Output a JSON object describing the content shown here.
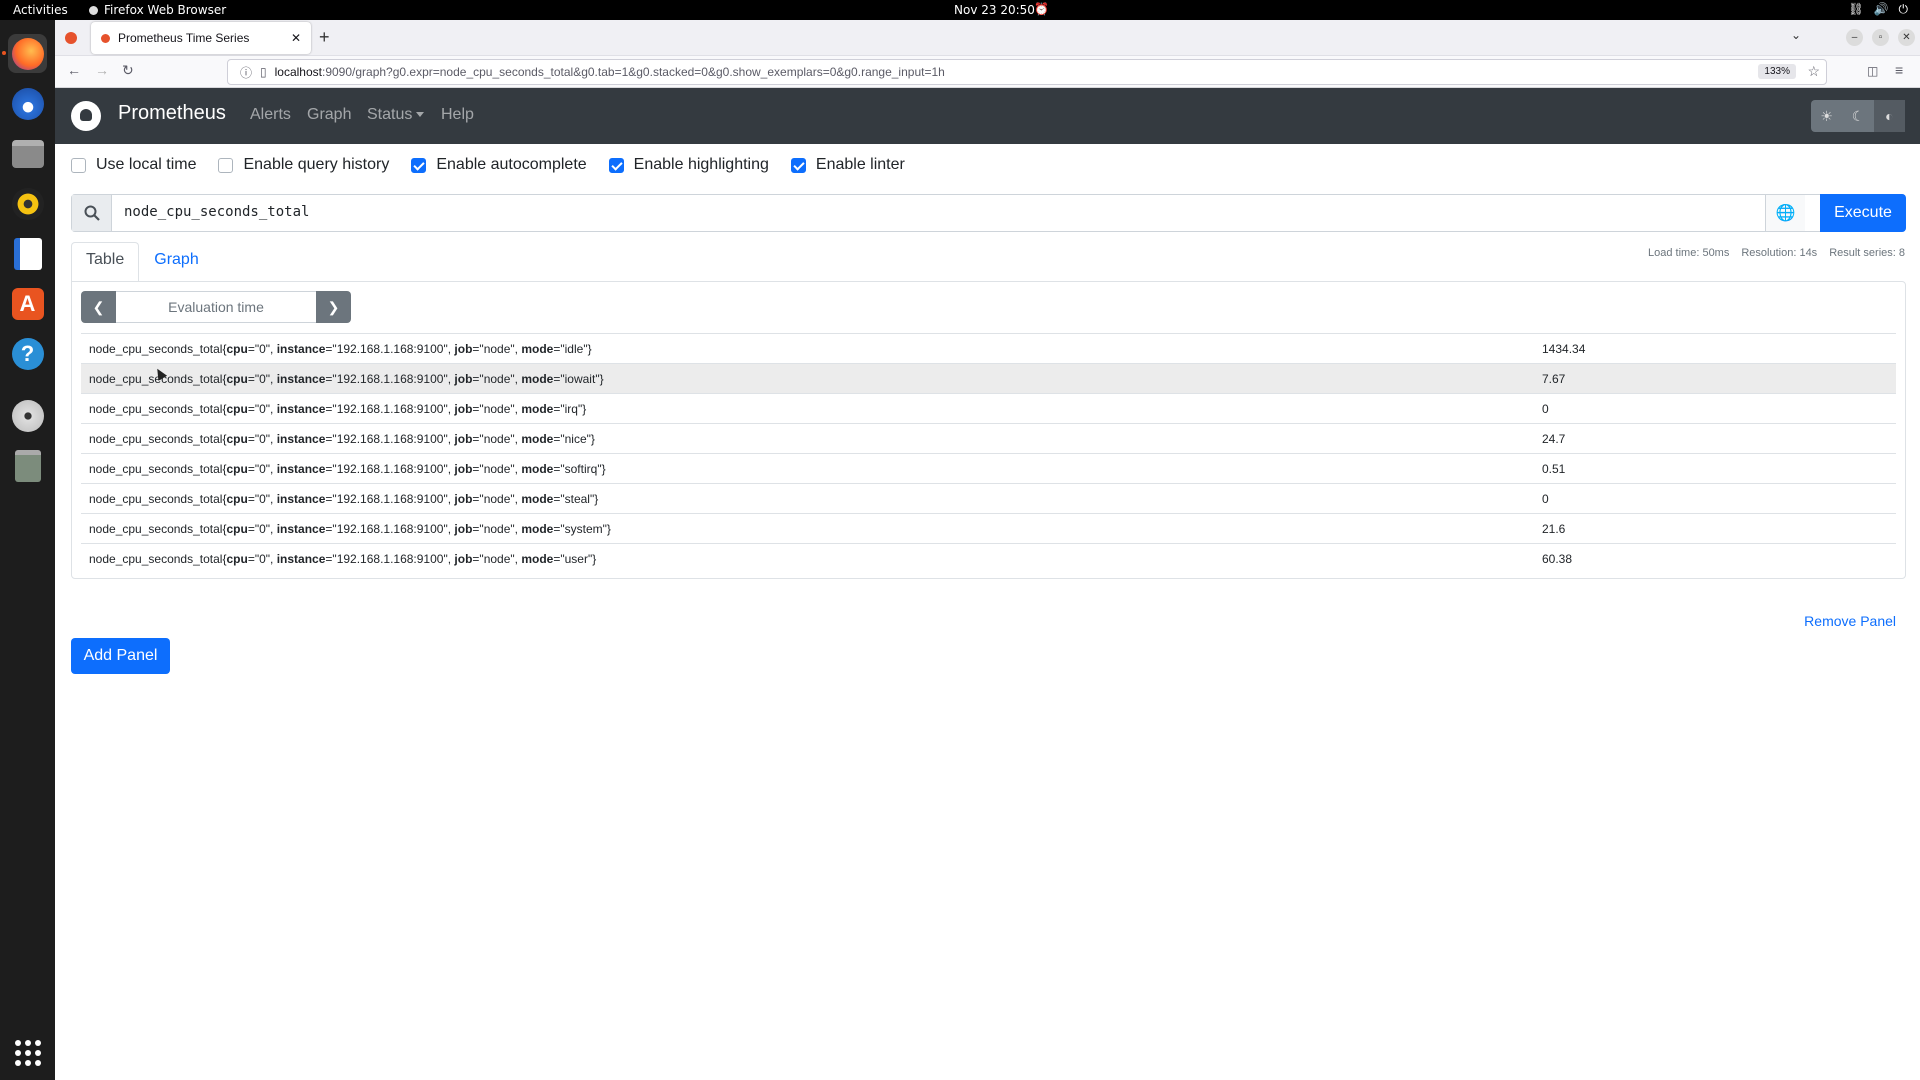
{
  "system": {
    "activities": "Activities",
    "app_name": "Firefox Web Browser",
    "clock": "Nov 23  20:50"
  },
  "browser": {
    "tab_title": "Prometheus Time Series",
    "url_host": "localhost",
    "url_path": ":9090/graph?g0.expr=node_cpu_seconds_total&g0.tab=1&g0.stacked=0&g0.show_exemplars=0&g0.range_input=1h",
    "zoom": "133%"
  },
  "prom": {
    "brand": "Prometheus",
    "nav": [
      "Alerts",
      "Graph",
      "Status",
      "Help"
    ]
  },
  "options": [
    {
      "label": "Use local time",
      "checked": false
    },
    {
      "label": "Enable query history",
      "checked": false
    },
    {
      "label": "Enable autocomplete",
      "checked": true
    },
    {
      "label": "Enable highlighting",
      "checked": true
    },
    {
      "label": "Enable linter",
      "checked": true
    }
  ],
  "query": {
    "expression": "node_cpu_seconds_total",
    "execute_label": "Execute"
  },
  "tabs": {
    "table": "Table",
    "graph": "Graph"
  },
  "stats": {
    "load_time": "Load time: 50ms",
    "resolution": "Resolution: 14s",
    "result_series": "Result series: 8"
  },
  "eval_time_placeholder": "Evaluation time",
  "results": [
    {
      "name": "node_cpu_seconds_total",
      "cpu": "0",
      "instance": "192.168.1.168:9100",
      "job": "node",
      "mode": "idle",
      "value": "1434.34"
    },
    {
      "name": "node_cpu_seconds_total",
      "cpu": "0",
      "instance": "192.168.1.168:9100",
      "job": "node",
      "mode": "iowait",
      "value": "7.67"
    },
    {
      "name": "node_cpu_seconds_total",
      "cpu": "0",
      "instance": "192.168.1.168:9100",
      "job": "node",
      "mode": "irq",
      "value": "0"
    },
    {
      "name": "node_cpu_seconds_total",
      "cpu": "0",
      "instance": "192.168.1.168:9100",
      "job": "node",
      "mode": "nice",
      "value": "24.7"
    },
    {
      "name": "node_cpu_seconds_total",
      "cpu": "0",
      "instance": "192.168.1.168:9100",
      "job": "node",
      "mode": "softirq",
      "value": "0.51"
    },
    {
      "name": "node_cpu_seconds_total",
      "cpu": "0",
      "instance": "192.168.1.168:9100",
      "job": "node",
      "mode": "steal",
      "value": "0"
    },
    {
      "name": "node_cpu_seconds_total",
      "cpu": "0",
      "instance": "192.168.1.168:9100",
      "job": "node",
      "mode": "system",
      "value": "21.6"
    },
    {
      "name": "node_cpu_seconds_total",
      "cpu": "0",
      "instance": "192.168.1.168:9100",
      "job": "node",
      "mode": "user",
      "value": "60.38"
    }
  ],
  "remove_panel": "Remove Panel",
  "add_panel": "Add Panel",
  "colors": {
    "primary": "#0d6efd",
    "navbar": "#343a40"
  }
}
